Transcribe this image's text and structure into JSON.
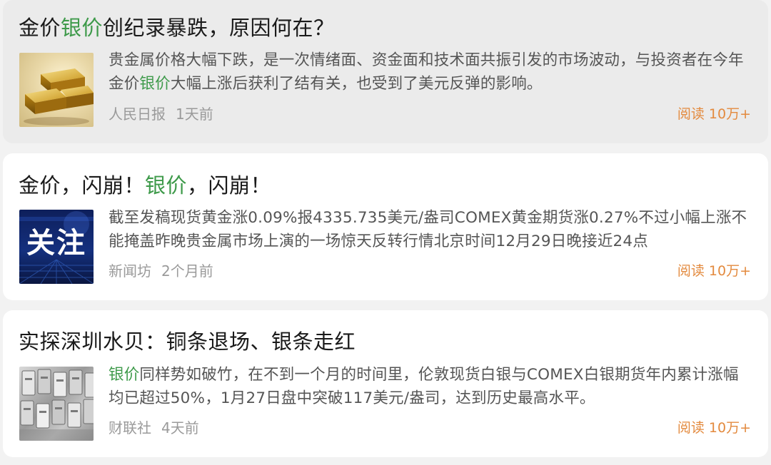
{
  "articles": [
    {
      "title_parts": [
        {
          "text": "金价",
          "highlight": false
        },
        {
          "text": "银价",
          "highlight": true
        },
        {
          "text": "创纪录暴跌，原因何在？",
          "highlight": false
        }
      ],
      "summary_parts": [
        {
          "text": "贵金属价格大幅下跌，是一次情绪面、资金面和技术面共振引发的市场波动，与投资者在今年金价",
          "highlight": false
        },
        {
          "text": "银价",
          "highlight": true
        },
        {
          "text": "大幅上涨后获利了结有关，也受到了美元反弹的影响。",
          "highlight": false
        }
      ],
      "source": "人民日报",
      "time": "1天前",
      "reads": "阅读 10万+",
      "thumbnail": "gold-bars-image"
    },
    {
      "title_parts": [
        {
          "text": "金价，闪崩！",
          "highlight": false
        },
        {
          "text": "银价",
          "highlight": true
        },
        {
          "text": "，闪崩！",
          "highlight": false
        }
      ],
      "summary_parts": [
        {
          "text": "截至发稿现货黄金涨0.09%报4335.735美元/盎司COMEX黄金期货涨0.27%不过小幅上涨不能掩盖昨晚贵金属市场上演的一场惊天反转行情北京时间12月29日晚接近24点",
          "highlight": false
        }
      ],
      "source": "新闻坊",
      "time": "2个月前",
      "reads": "阅读 10万+",
      "thumbnail": "focus-banner-image",
      "thumbnail_text": "关注"
    },
    {
      "title_parts": [
        {
          "text": "实探深圳水贝：铜条退场、银条走红",
          "highlight": false
        }
      ],
      "summary_parts": [
        {
          "text": "银价",
          "highlight": true
        },
        {
          "text": "同样势如破竹，在不到一个月的时间里，伦敦现货白银与COMEX白银期货年内累计涨幅均已超过50%，1月27日盘中突破117美元/盎司，达到历史最高水平。",
          "highlight": false
        }
      ],
      "source": "财联社",
      "time": "4天前",
      "reads": "阅读 10万+",
      "thumbnail": "silver-bars-image"
    }
  ],
  "colors": {
    "highlight": "#3e9a4a",
    "reads": "#e38a3e",
    "meta": "#9a9a9a",
    "title": "#1a1a1a",
    "summary": "#555555"
  }
}
